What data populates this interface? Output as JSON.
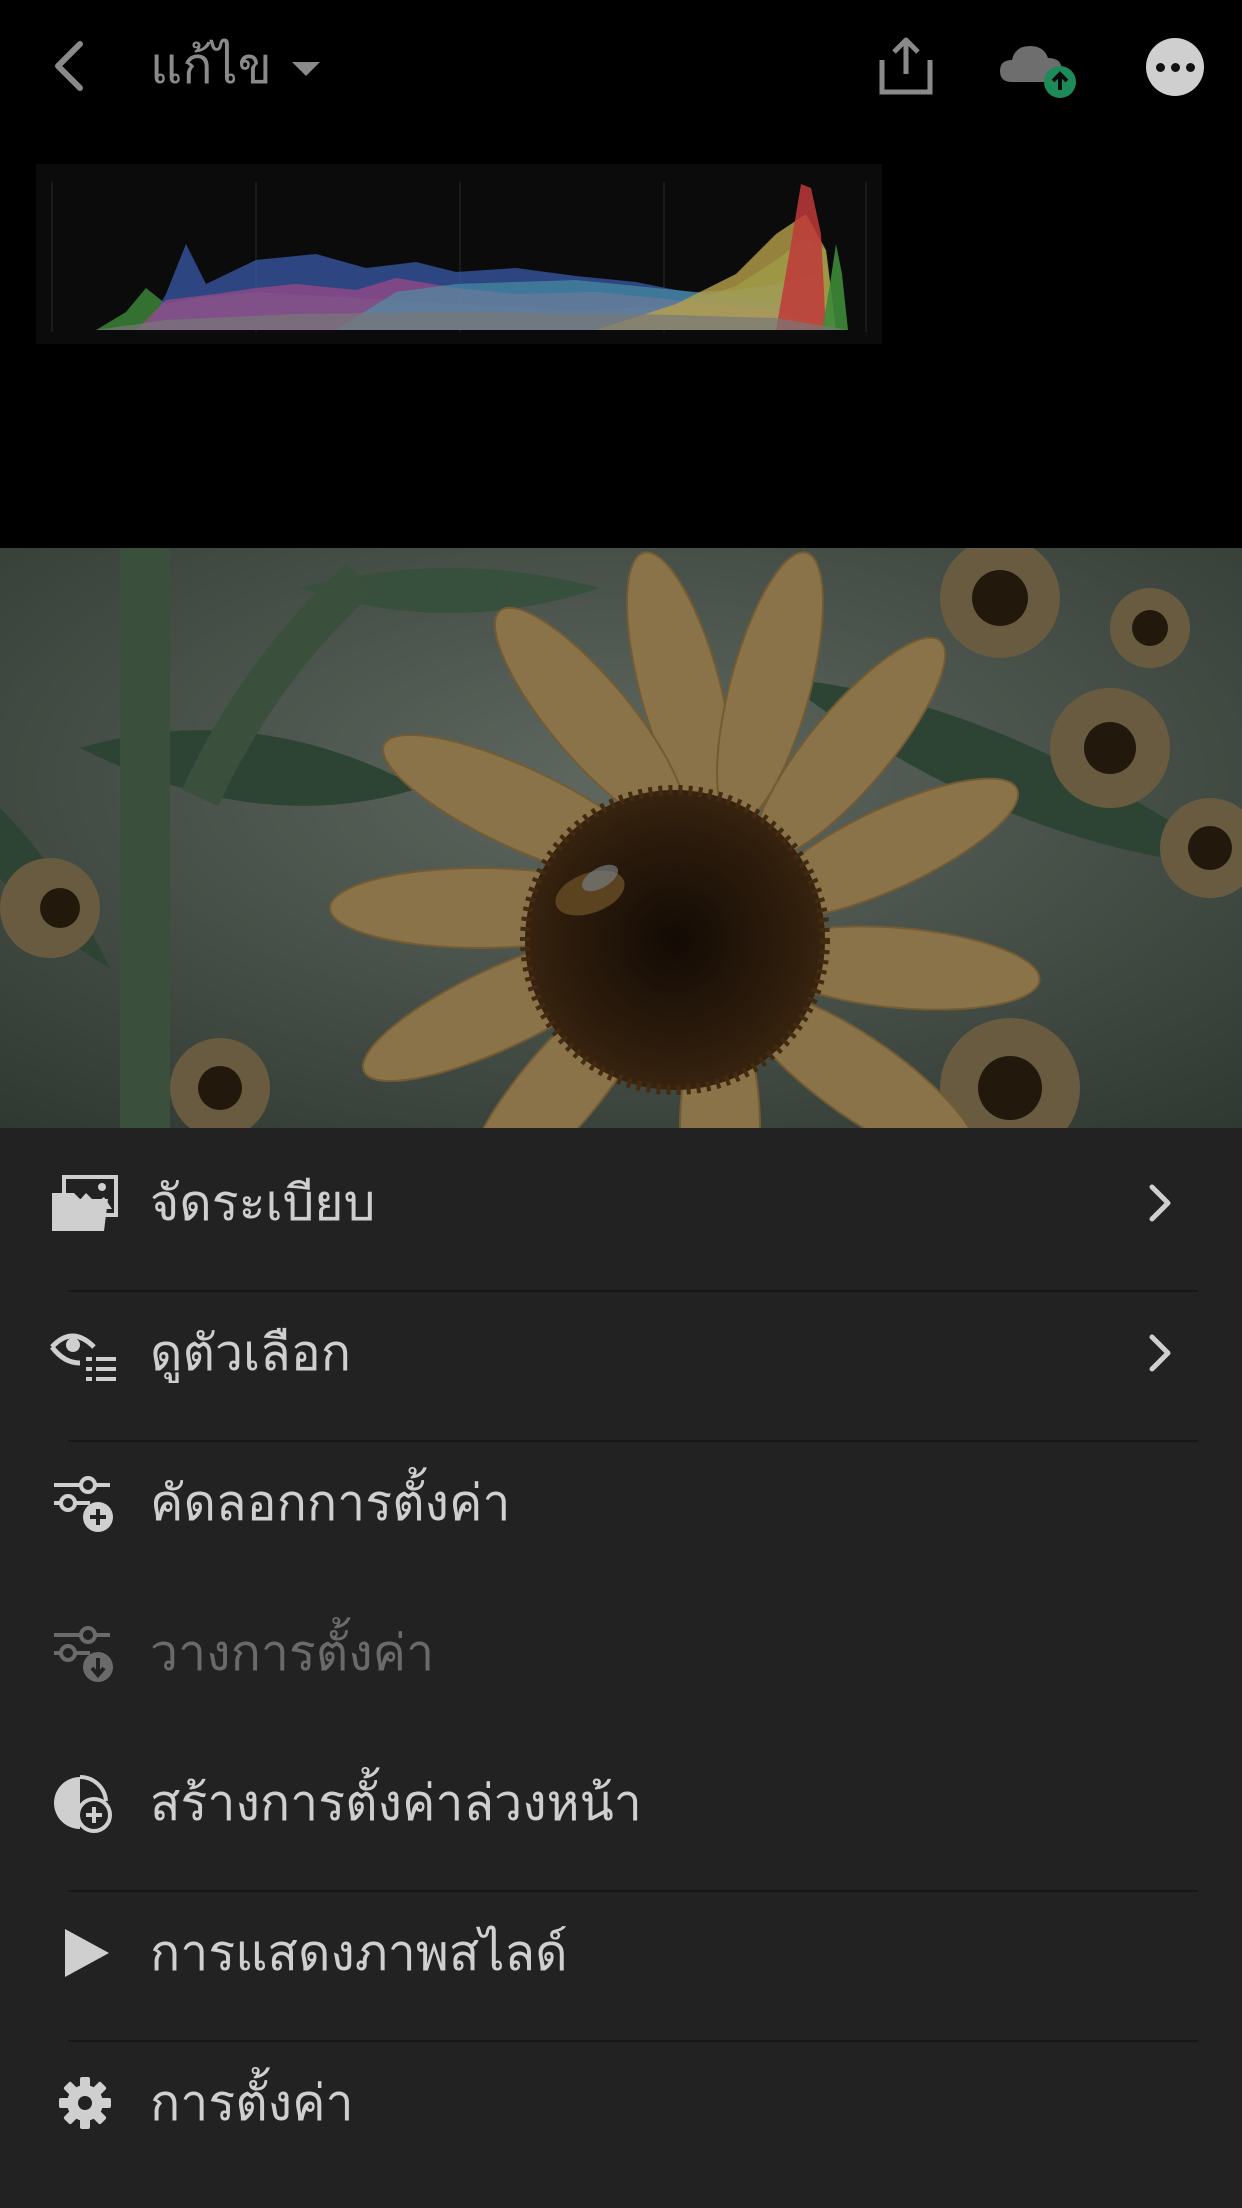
{
  "header": {
    "title": "แก้ไข",
    "back_icon": "chevron-left-icon",
    "share_icon": "share-icon",
    "cloud_icon": "cloud-upload-icon",
    "more_icon": "more-icon"
  },
  "histogram": {
    "colors": {
      "red": "#c03a3a",
      "green": "#3e8a3a",
      "blue": "#3a5aa8",
      "yellow": "#b8a04a",
      "cyan": "#4a9aa8",
      "magenta": "#a04a88"
    }
  },
  "menu": {
    "items": [
      {
        "label": "จัดระเบียบ",
        "icon": "organize-folder-icon",
        "has_chevron": true,
        "enabled": true
      },
      {
        "label": "ดูตัวเลือก",
        "icon": "view-options-icon",
        "has_chevron": true,
        "enabled": true
      },
      {
        "label": "คัดลอกการตั้งค่า",
        "icon": "copy-settings-icon",
        "has_chevron": false,
        "enabled": true
      },
      {
        "label": "วางการตั้งค่า",
        "icon": "paste-settings-icon",
        "has_chevron": false,
        "enabled": false
      },
      {
        "label": "สร้างการตั้งค่าล่วงหน้า",
        "icon": "create-preset-icon",
        "has_chevron": false,
        "enabled": true
      },
      {
        "label": "การแสดงภาพสไลด์",
        "icon": "play-icon",
        "has_chevron": false,
        "enabled": true
      },
      {
        "label": "การตั้งค่า",
        "icon": "gear-icon",
        "has_chevron": false,
        "enabled": true
      }
    ]
  },
  "colors": {
    "background": "#000000",
    "sheet": "#222222",
    "text": "#cfcfcf",
    "text_disabled": "#6a6a6a",
    "cloud_badge": "#1e8a5a"
  }
}
